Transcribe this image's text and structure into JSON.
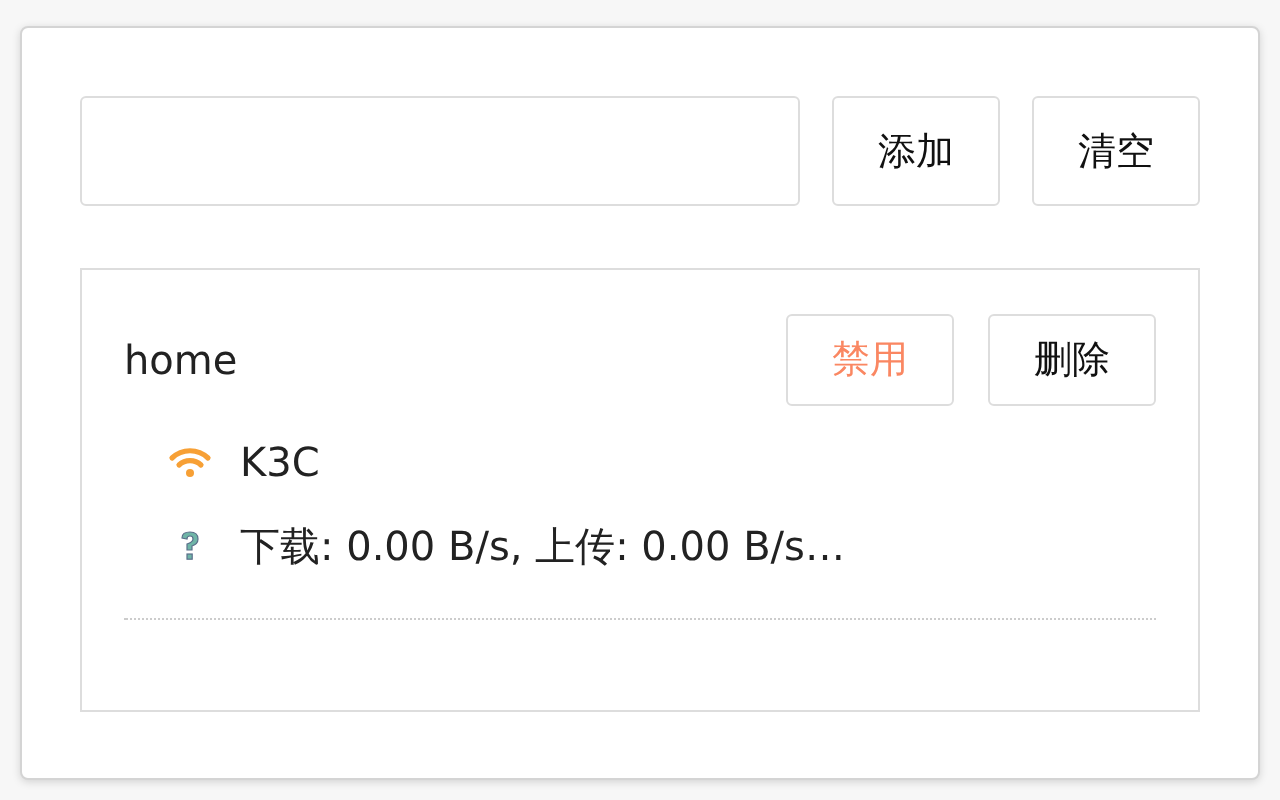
{
  "buttons": [
    {
      "label": "添加"
    },
    {
      "label": "清空"
    }
  ],
  "groups": [
    {
      "name": "home",
      "actions": [
        {
          "label": "禁用",
          "kind": "warn"
        },
        {
          "label": "删除",
          "kind": "normal"
        }
      ],
      "items": [
        {
          "kind": "wifi",
          "text": "K3C"
        },
        {
          "kind": "unknown",
          "text": "下载: 0.00 B/s, 上传: 0.00 B/s…"
        }
      ]
    }
  ]
}
